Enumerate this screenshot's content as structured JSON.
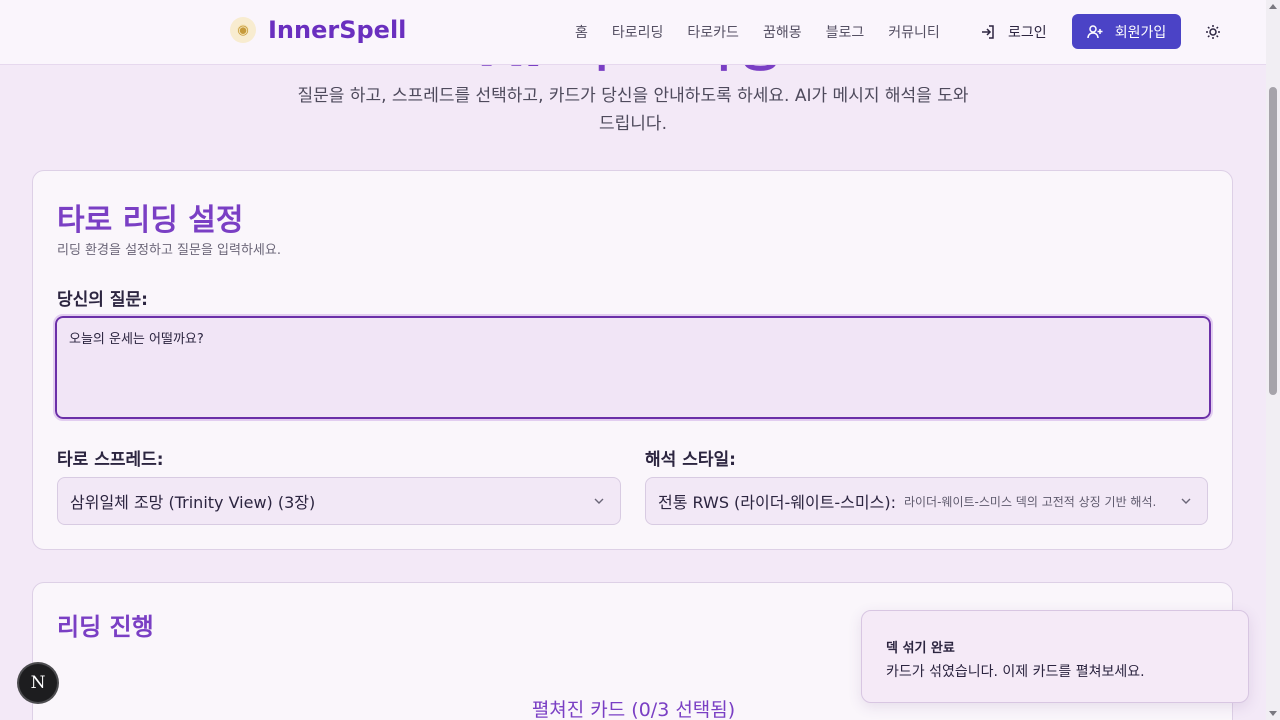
{
  "page": {
    "hero_title": "AI 타로 리딩",
    "subtitle": "질문을 하고, 스프레드를 선택하고, 카드가 당신을 안내하도록 하세요. AI가 메시지 해석을 도와드립니다."
  },
  "header": {
    "logo_text": "InnerSpell",
    "logo_icon": "eye-icon",
    "nav": [
      "홈",
      "타로리딩",
      "타로카드",
      "꿈해몽",
      "블로그",
      "커뮤니티"
    ],
    "login_label": "로그인",
    "signup_label": "회원가입",
    "theme_icon": "sun-icon"
  },
  "settings": {
    "title": "타로 리딩 설정",
    "description": "리딩 환경을 설정하고 질문을 입력하세요.",
    "question_label": "당신의 질문:",
    "question_value": "오늘의 운세는 어떨까요?",
    "spread_label": "타로 스프레드:",
    "spread_value": "삼위일체 조망 (Trinity View) (3장)",
    "style_label": "해석 스타일:",
    "style_value": "전통 RWS (라이더-웨이트-스미스):",
    "style_detail": "라이더-웨이트-스미스 덱의 고전적 상징 기반 해석."
  },
  "progress": {
    "title": "리딩 진행",
    "spread_status": "펼쳐진 카드 (0/3 선택됨)"
  },
  "toast": {
    "title": "덱 섞기 완료",
    "body": "카드가 섞였습니다. 이제 카드를 펼쳐보세요."
  },
  "badge": {
    "label": "N"
  },
  "colors": {
    "accent": "#7a3fc4",
    "primary_button": "#4b43c6",
    "background": "#f3e9f7"
  }
}
